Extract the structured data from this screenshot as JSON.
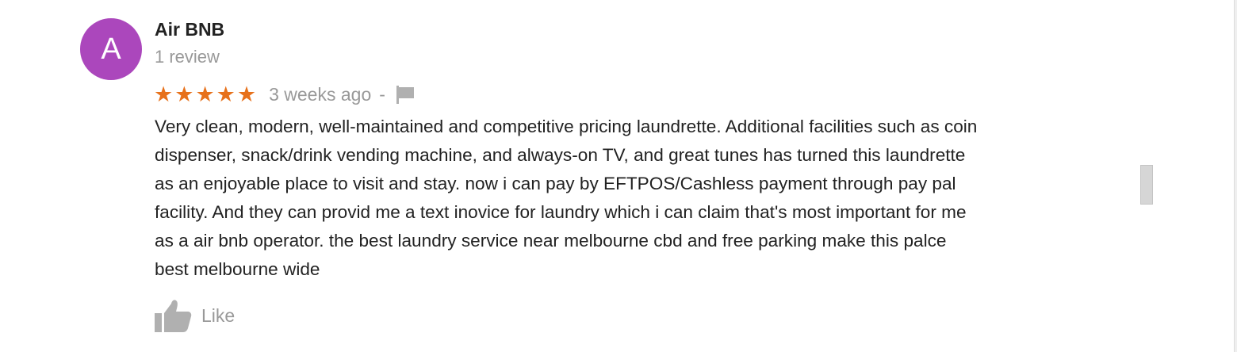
{
  "author": {
    "initial": "A",
    "name": "Air BNB",
    "review_count": "1 review"
  },
  "rating": {
    "stars": 5,
    "max": 5
  },
  "time_ago": "3 weeks ago",
  "separator": "-",
  "review_text": "Very clean, modern, well-maintained and competitive pricing laundrette. Additional facilities such as coin\ndispenser, snack/drink vending machine, and always-on TV, and great tunes has turned this laundrette\nas an enjoyable place to visit and stay. now i can pay by  EFTPOS/Cashless payment through pay pal\nfacility. And they can provid me a text inovice for laundry which i can claim that's most important for me\nas a air bnb operator. the best laundry service near melbourne cbd and free parking make this palce\nbest  melbourne wide",
  "like": {
    "label": "Like"
  },
  "icons": {
    "star": "star-icon",
    "flag": "flag-icon",
    "like": "thumbs-up-icon"
  },
  "colors": {
    "avatar_bg": "#ab47bc",
    "star": "#e7711b",
    "muted": "#999999",
    "icon": "#b0b0b0",
    "text": "#222222"
  }
}
